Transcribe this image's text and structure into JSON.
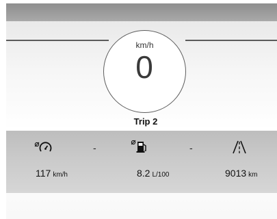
{
  "speedometer": {
    "unit": "km/h",
    "value": "0"
  },
  "trip": {
    "label": "Trip 2"
  },
  "readouts": [
    {
      "icon": "average-speed-icon",
      "placeholder": "-",
      "value": "117",
      "unit": "km/h"
    },
    {
      "icon": "average-fuel-icon",
      "placeholder": "-",
      "value": "8.2",
      "unit": "L/100"
    },
    {
      "icon": "road-distance-icon",
      "value": "9013",
      "unit": "km"
    }
  ],
  "colors": {
    "top_bar": "#999999",
    "band": "#c8c8c8",
    "dial_border": "#5c5c5c"
  }
}
